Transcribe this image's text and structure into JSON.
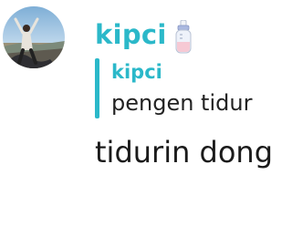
{
  "message": {
    "avatar_icon": "user-avatar-photo",
    "username": "kipci",
    "badge_icon": "baby-bottle-icon",
    "reply": {
      "author": "kipci",
      "text": "pengen tidur"
    },
    "text": "tidurin dong"
  },
  "colors": {
    "accent": "#2bb8c9",
    "text": "#1a1a1a",
    "background": "#ffffff"
  }
}
